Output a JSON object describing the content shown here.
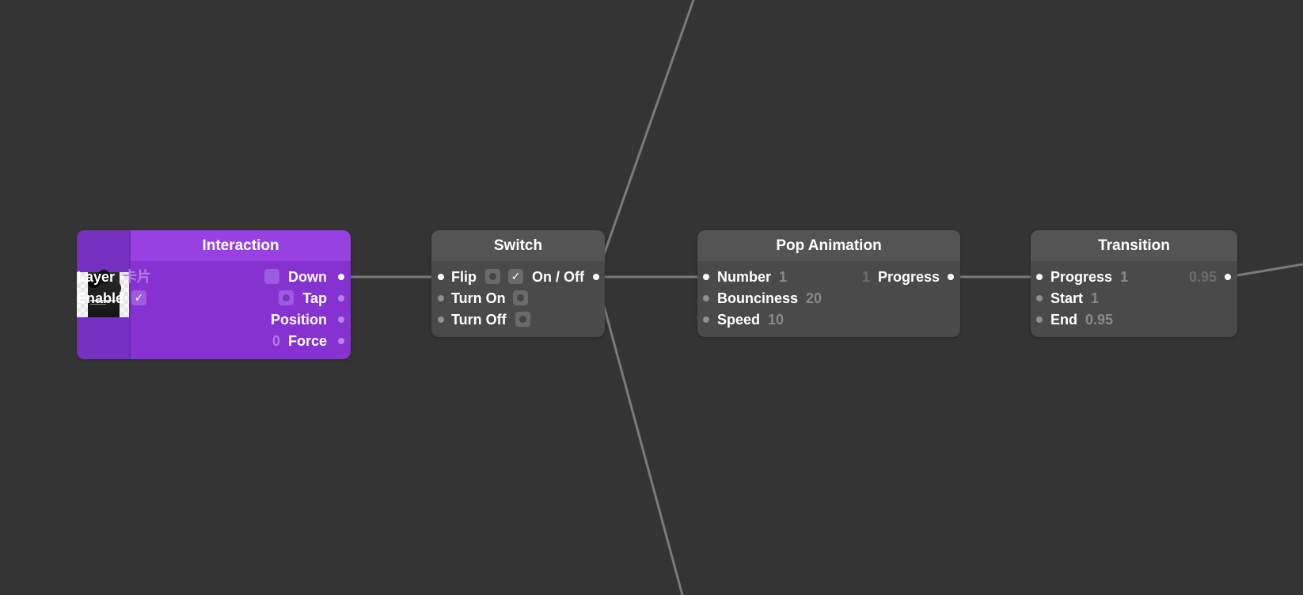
{
  "nodes": {
    "interaction": {
      "title": "Interaction",
      "accent_color": "#8532d0",
      "thumbnail_icon": "layer-thumbnail-image",
      "inputs": [
        {
          "label": "Layer",
          "value": "卡片"
        },
        {
          "label": "Enable",
          "value": "✓"
        }
      ],
      "outputs": [
        {
          "label": "Down",
          "control": "empty-box"
        },
        {
          "label": "Tap",
          "control": "pulse-button"
        },
        {
          "label": "Position"
        },
        {
          "label": "Force",
          "value": "0"
        }
      ]
    },
    "switch": {
      "title": "Switch",
      "inputs": [
        {
          "label": "Flip",
          "control": "pulse-button"
        },
        {
          "label": "Turn On",
          "control": "pulse-button"
        },
        {
          "label": "Turn Off",
          "control": "pulse-button"
        }
      ],
      "outputs": [
        {
          "label": "On / Off",
          "value": "✓"
        }
      ]
    },
    "pop_animation": {
      "title": "Pop Animation",
      "inputs": [
        {
          "label": "Number",
          "value": "1"
        },
        {
          "label": "Bounciness",
          "value": "20"
        },
        {
          "label": "Speed",
          "value": "10"
        }
      ],
      "outputs": [
        {
          "label": "Progress",
          "value": "1"
        }
      ]
    },
    "transition": {
      "title": "Transition",
      "inputs": [
        {
          "label": "Progress",
          "value": "1"
        },
        {
          "label": "Start",
          "value": "1"
        },
        {
          "label": "End",
          "value": "0.95"
        }
      ],
      "outputs": [
        {
          "value": "0.95"
        }
      ]
    }
  },
  "colors": {
    "canvas": "#343434",
    "node_gray": "#4a4a4a",
    "wire": "#7a7a7a",
    "interaction_purple": "#8532d0"
  }
}
